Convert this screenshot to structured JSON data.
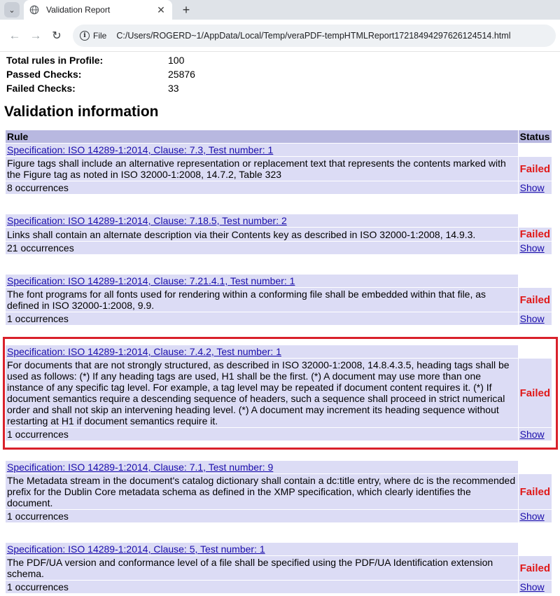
{
  "browser": {
    "tab_title": "Validation Report",
    "new_tab_label": "+",
    "file_chip_label": "File",
    "url": "C:/Users/ROGERD~1/AppData/Local/Temp/veraPDF-tempHTMLReport17218494297626124514.html"
  },
  "summary": [
    {
      "label": "Total rules in Profile:",
      "value": "100"
    },
    {
      "label": "Passed Checks:",
      "value": "25876"
    },
    {
      "label": "Failed Checks:",
      "value": "33"
    }
  ],
  "section_title": "Validation information",
  "table": {
    "headers": {
      "rule": "Rule",
      "status": "Status"
    },
    "show_label": "Show",
    "rules": [
      {
        "spec": "Specification: ISO 14289-1:2014, Clause: 7.3, Test number: 1",
        "description": "Figure tags shall include an alternative representation or replacement text that represents the contents marked with the Figure tag as noted in ISO 32000-1:2008, 14.7.2, Table 323",
        "status": "Failed",
        "occurrences": "8 occurrences"
      },
      {
        "spec": "Specification: ISO 14289-1:2014, Clause: 7.18.5, Test number: 2",
        "description": "Links shall contain an alternate description via their Contents key as described in ISO 32000-1:2008, 14.9.3.",
        "status": "Failed",
        "occurrences": "21 occurrences"
      },
      {
        "spec": "Specification: ISO 14289-1:2014, Clause: 7.21.4.1, Test number: 1",
        "description": "The font programs for all fonts used for rendering within a conforming file shall be embedded within that file, as defined in ISO 32000-1:2008, 9.9.",
        "status": "Failed",
        "occurrences": "1 occurrences"
      },
      {
        "spec": "Specification: ISO 14289-1:2014, Clause: 7.4.2, Test number: 1",
        "description": "For documents that are not strongly structured, as described in ISO 32000-1:2008, 14.8.4.3.5, heading tags shall be used as follows: (*) If any heading tags are used, H1 shall be the first. (*) A document may use more than one instance of any specific tag level. For example, a tag level may be repeated if document content requires it. (*) If document semantics require a descending sequence of headers, such a sequence shall proceed in strict numerical order and shall not skip an intervening heading level. (*) A document may increment its heading sequence without restarting at H1 if document semantics require it.",
        "status": "Failed",
        "occurrences": "1 occurrences"
      },
      {
        "spec": "Specification: ISO 14289-1:2014, Clause: 7.1, Test number: 9",
        "description": "The Metadata stream in the document's catalog dictionary shall contain a dc:title entry, where dc is the recommended prefix for the Dublin Core metadata schema as defined in the XMP specification, which clearly identifies the document.",
        "status": "Failed",
        "occurrences": "1 occurrences"
      },
      {
        "spec": "Specification: ISO 14289-1:2014, Clause: 5, Test number: 1",
        "description": "The PDF/UA version and conformance level of a file shall be specified using the PDF/UA Identification extension schema.",
        "status": "Failed",
        "occurrences": "1 occurrences"
      }
    ]
  }
}
